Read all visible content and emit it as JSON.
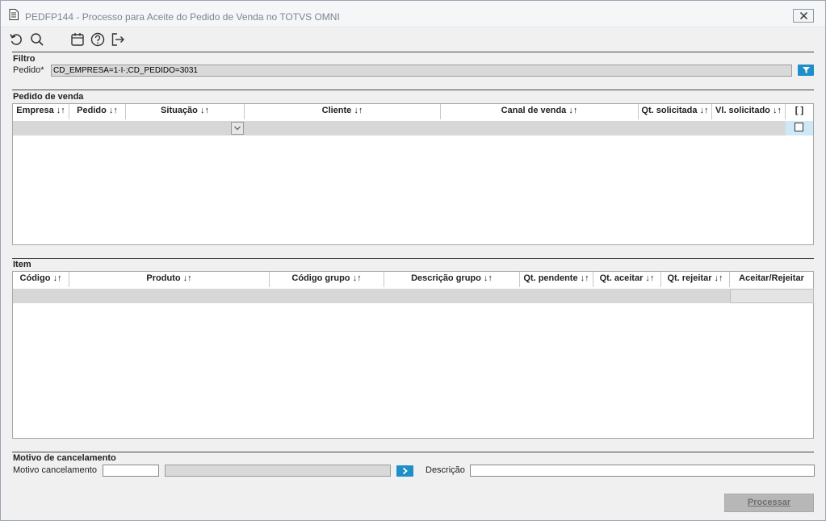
{
  "window": {
    "title": "PEDFP144 - Processo para Aceite do Pedido de Venda no TOTVS OMNI"
  },
  "toolbar": {
    "icons": [
      "refresh-icon",
      "search-icon",
      "calendar-icon",
      "help-icon",
      "exit-icon"
    ]
  },
  "filtro": {
    "title": "Filtro",
    "pedido_label": "Pedido*",
    "pedido_value": "CD_EMPRESA=1·I·;CD_PEDIDO=3031"
  },
  "pedido_venda": {
    "title": "Pedido de venda",
    "columns": [
      "Empresa ↓↑",
      "Pedido ↓↑",
      "Situação ↓↑",
      "Cliente ↓↑",
      "Canal de venda ↓↑",
      "Qt. solicitada ↓↑",
      "Vl. solicitado ↓↑",
      "[ ]"
    ]
  },
  "item": {
    "title": "Item",
    "columns": [
      "Código ↓↑",
      "Produto ↓↑",
      "Código grupo ↓↑",
      "Descrição grupo ↓↑",
      "Qt. pendente ↓↑",
      "Qt. aceitar ↓↑",
      "Qt. rejeitar ↓↑",
      "Aceitar/Rejeitar"
    ]
  },
  "motivo": {
    "title": "Motivo de cancelamento",
    "motivo_label": "Motivo cancelamento",
    "motivo_code": "",
    "motivo_desc": "",
    "descricao_label": "Descrição",
    "descricao_value": ""
  },
  "actions": {
    "process_label": "Processar"
  },
  "colors": {
    "accent": "#1e8fc8",
    "row_bg": "#d7d7d7",
    "check_bg": "#cfe8f5"
  }
}
